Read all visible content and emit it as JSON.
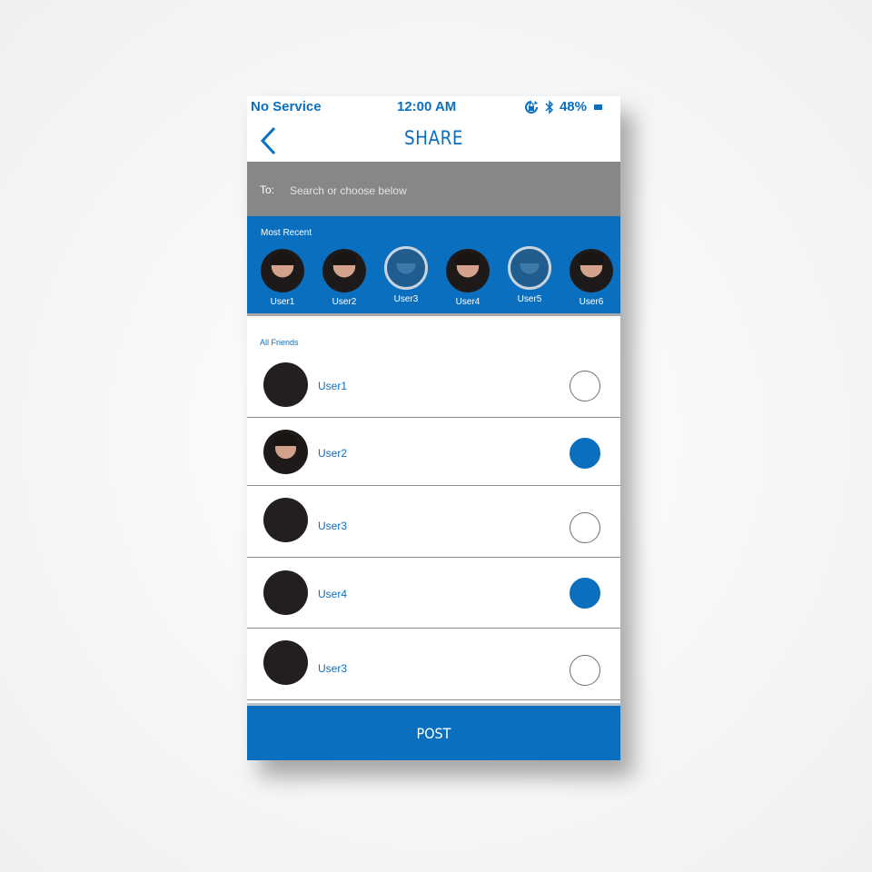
{
  "status_bar": {
    "carrier": "No Service",
    "time": "12:00 AM",
    "battery": "48%"
  },
  "header": {
    "title": "SHARE"
  },
  "search": {
    "to_label": "To:",
    "placeholder": "Search or choose below"
  },
  "most_recent": {
    "label": "Most Recent",
    "users": [
      {
        "name": "User1",
        "selected": false
      },
      {
        "name": "User2",
        "selected": false
      },
      {
        "name": "User3",
        "selected": true
      },
      {
        "name": "User4",
        "selected": false
      },
      {
        "name": "User5",
        "selected": true
      },
      {
        "name": "User6",
        "selected": false
      }
    ]
  },
  "all_friends": {
    "label": "All Friends",
    "rows": [
      {
        "name": "User1",
        "checked": false,
        "has_photo": false
      },
      {
        "name": "User2",
        "checked": true,
        "has_photo": true
      },
      {
        "name": "User3",
        "checked": false,
        "has_photo": false
      },
      {
        "name": "User4",
        "checked": true,
        "has_photo": false
      },
      {
        "name": "User3",
        "checked": false,
        "has_photo": false
      }
    ]
  },
  "post_button": {
    "label": "POST"
  },
  "colors": {
    "accent": "#0a6fbf",
    "search_bar": "#878787",
    "avatar_placeholder": "#231f20"
  }
}
